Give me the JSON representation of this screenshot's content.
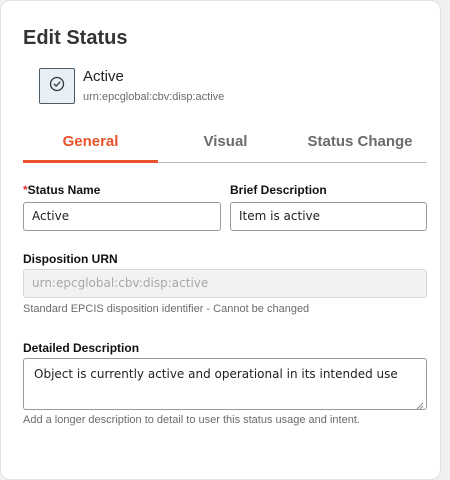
{
  "panel": {
    "title": "Edit Status"
  },
  "status": {
    "name": "Active",
    "urn": "urn:epcglobal:cbv:disp:active",
    "icon": "check-circle-icon"
  },
  "tabs": [
    {
      "label": "General",
      "active": true
    },
    {
      "label": "Visual",
      "active": false
    },
    {
      "label": "Status Change",
      "active": false
    }
  ],
  "form": {
    "status_name": {
      "required_mark": "*",
      "label": "Status Name",
      "value": "Active"
    },
    "brief_description": {
      "label": "Brief Description",
      "value": "Item is active"
    },
    "disposition_urn": {
      "label": "Disposition URN",
      "value": "urn:epcglobal:cbv:disp:active",
      "help": "Standard EPCIS disposition identifier - Cannot be changed"
    },
    "detailed_description": {
      "label": "Detailed Description",
      "value": "Object is currently active and operational in its intended use",
      "help": "Add a longer description to detail to user this status usage and intent."
    }
  },
  "colors": {
    "accent": "#e8532b",
    "required": "#e0322a"
  }
}
